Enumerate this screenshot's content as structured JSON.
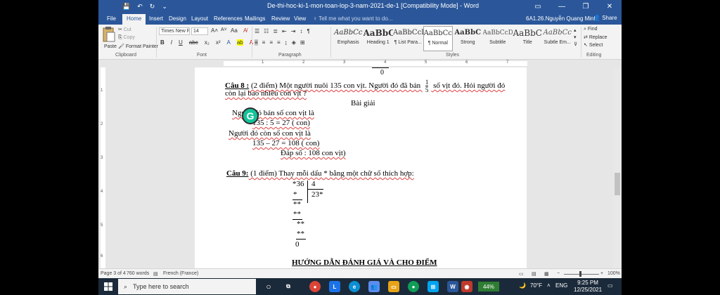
{
  "titlebar": {
    "title": "De-thi-hoc-ki-1-mon-toan-lop-3-nam-2021-de-1 [Compatibility Mode]  -  Word",
    "minimize": "—",
    "restore": "❐",
    "close": "✕"
  },
  "tabs": [
    "File",
    "Home",
    "Insert",
    "Design",
    "Layout",
    "References",
    "Mailings",
    "Review",
    "View"
  ],
  "tell_me": "Tell me what you want to do...",
  "user": "6A1.26.Nguyễn Quang Minh",
  "share": "Share",
  "clipboard": {
    "paste": "Paste",
    "cut": "Cut",
    "copy": "Copy",
    "format_painter": "Format Painter",
    "label": "Clipboard"
  },
  "font": {
    "name": "Times New R",
    "size": "14",
    "label": "Font"
  },
  "paragraph": {
    "label": "Paragraph"
  },
  "styles": {
    "label": "Styles",
    "items": [
      {
        "sample": "AaBbCc",
        "name": "Emphasis"
      },
      {
        "sample": "AaBbC",
        "name": "Heading 1"
      },
      {
        "sample": "AaBbCcI",
        "name": "¶ List Para..."
      },
      {
        "sample": "AaBbCc",
        "name": "¶ Normal"
      },
      {
        "sample": "AaBbC",
        "name": "Strong"
      },
      {
        "sample": "AaBbCcD",
        "name": "Subtitle"
      },
      {
        "sample": "AaBbC",
        "name": "Title"
      },
      {
        "sample": "AaBbCc",
        "name": "Subtle Em..."
      }
    ]
  },
  "editing": {
    "find": "Find",
    "replace": "Replace",
    "select": "Select",
    "label": "Editing"
  },
  "ruler_numbers": [
    "1",
    "2",
    "3",
    "4",
    "5",
    "6",
    "7"
  ],
  "vruler_numbers": [
    "1",
    "2",
    "3",
    "4",
    "5",
    "6"
  ],
  "document": {
    "top_zero": "0",
    "q8_label": "Câu 8 :",
    "q8_text1": " (2 điểm) Một người nuôi 135 con vịt. Người đó đã bán ",
    "q8_frac_num": "1",
    "q8_frac_den": "5",
    "q8_text2": " số vịt đó. Hỏi người đó",
    "q8_text3": "còn lại bao nhiêu con vịt ?",
    "solution_title": "Bài giải",
    "sol_line1": "Người đó bán số con vịt là",
    "sol_line2": "135 : 5 = 27 ( con)",
    "sol_line3": "Người đó còn số con vịt là",
    "sol_line4": "135 – 27 = 108 ( con)",
    "sol_line5": "Đáp số : 108 con vịt)",
    "q9_label": "Câu 9:",
    "q9_text": " (1 điểm) Thay mỗi dấu * bằng một chữ số thích hợp:",
    "div_dividend": "*36",
    "div_divisor": "4",
    "div_quotient": "23*",
    "div_r1": "*",
    "div_r2": "**",
    "div_r3": "**",
    "div_r4": "**",
    "div_r5": "**",
    "div_r6": "0",
    "footer_heading": "HƯỚNG DẪN ĐÁNH GIÁ VÀ CHO ĐIỂM"
  },
  "status": {
    "page": "Page 3 of 4",
    "words": "760 words",
    "language": "French (France)",
    "zoom": "100%"
  },
  "taskbar": {
    "search_placeholder": "Type here to search",
    "battery": "44%",
    "weather": "70°F",
    "lang": "ENG",
    "time": "9:25 PM",
    "date": "12/25/2021"
  }
}
